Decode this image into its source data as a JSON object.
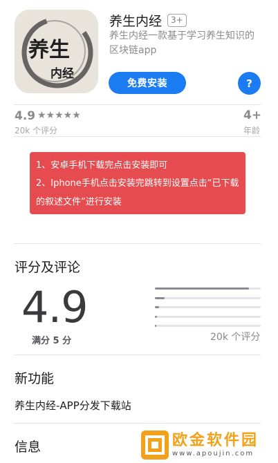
{
  "app": {
    "name": "养生内经",
    "age_badge": "3+",
    "description": "养生内经一款基于学习养生知识的区块链app",
    "install_label": "免费安装",
    "help_label": "?"
  },
  "icon_art": {
    "text_top": "养生",
    "text_bottom": "内经"
  },
  "summary": {
    "rating": "4.9",
    "stars": "★★★★★",
    "rating_count": "20k 个评分",
    "age": "4+",
    "age_label": "年龄"
  },
  "notice": {
    "line1": "1、安卓手机下载完点击安装即可",
    "line2": "2、Iphone手机点击安装完跳转到设置点击“已下载的叙述文件”进行安装",
    "color": "#e54b4f"
  },
  "ratings_section": {
    "title": "评分及评论",
    "score": "4.9",
    "out_of": "满分 5 分",
    "review_count": "20k 个评分",
    "distribution": [
      0.89,
      0.09,
      0.04,
      0.02,
      0.01
    ]
  },
  "new_features": {
    "title": "新功能",
    "text": "养生内经-APP分发下载站"
  },
  "info": {
    "title": "信息"
  },
  "watermark": {
    "title": "欧金软件园",
    "url": "www.apoujin.com"
  },
  "colors": {
    "accent": "#1a7cf0",
    "watermark": "#f2a21a"
  }
}
